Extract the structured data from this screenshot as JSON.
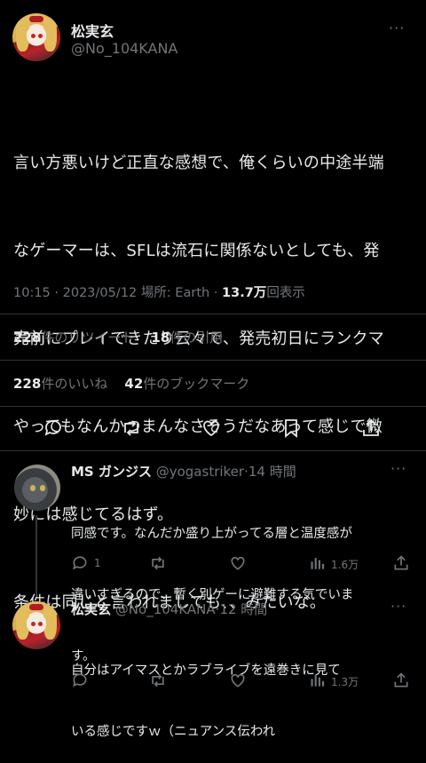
{
  "main_tweet": {
    "display_name": "松実玄",
    "handle": "@No_104KANA",
    "text_lines": [
      "言い方悪いけど正直な感想で、俺くらいの中途半端",
      "なゲーマーは、SFLは流石に関係ないとしても、発",
      "売前にプレイできたり云々で、発売初日にランクマ",
      "やってもなんかつまんなさそうだなあって感じで微",
      "妙には感じてるはず。",
      "条件は同じと言われましても、、みたいな。"
    ],
    "time": "10:15",
    "date": "2023/05/12",
    "location_label": "場所: Earth",
    "views_count": "13.7万",
    "views_label": "回表示",
    "retweets_count": "228",
    "retweets_label": "件のリツイート",
    "quotes_count": "18",
    "quotes_label": "件の引用",
    "likes_count": "228",
    "likes_label": "件のいいね",
    "bookmarks_count": "42",
    "bookmarks_label": "件のブックマーク"
  },
  "replies": [
    {
      "display_name": "MS ガンジス",
      "handle": "@yogastriker",
      "time_ago": "14 時間",
      "text_lines": [
        "同感です。なんだか盛り上がってる層と温度感が",
        "違いすぎるので、暫く別ゲーに避難する気でいま",
        "す。"
      ],
      "reply_count": "1",
      "views": "1.6万"
    },
    {
      "display_name": "松実玄",
      "handle": "@No_104KANA",
      "time_ago": "12 時間",
      "text_lines": [
        "自分はアイマスとかラブライブを遠巻きに見て",
        "いる感じですｗ（ニュアンス伝われ"
      ],
      "views": "1.3万"
    }
  ],
  "separator": "·",
  "more_icon_label": "···",
  "colors": {
    "background": "#000000",
    "text": "#e7e9ea",
    "muted": "#71767b",
    "divider": "#2f3336"
  }
}
